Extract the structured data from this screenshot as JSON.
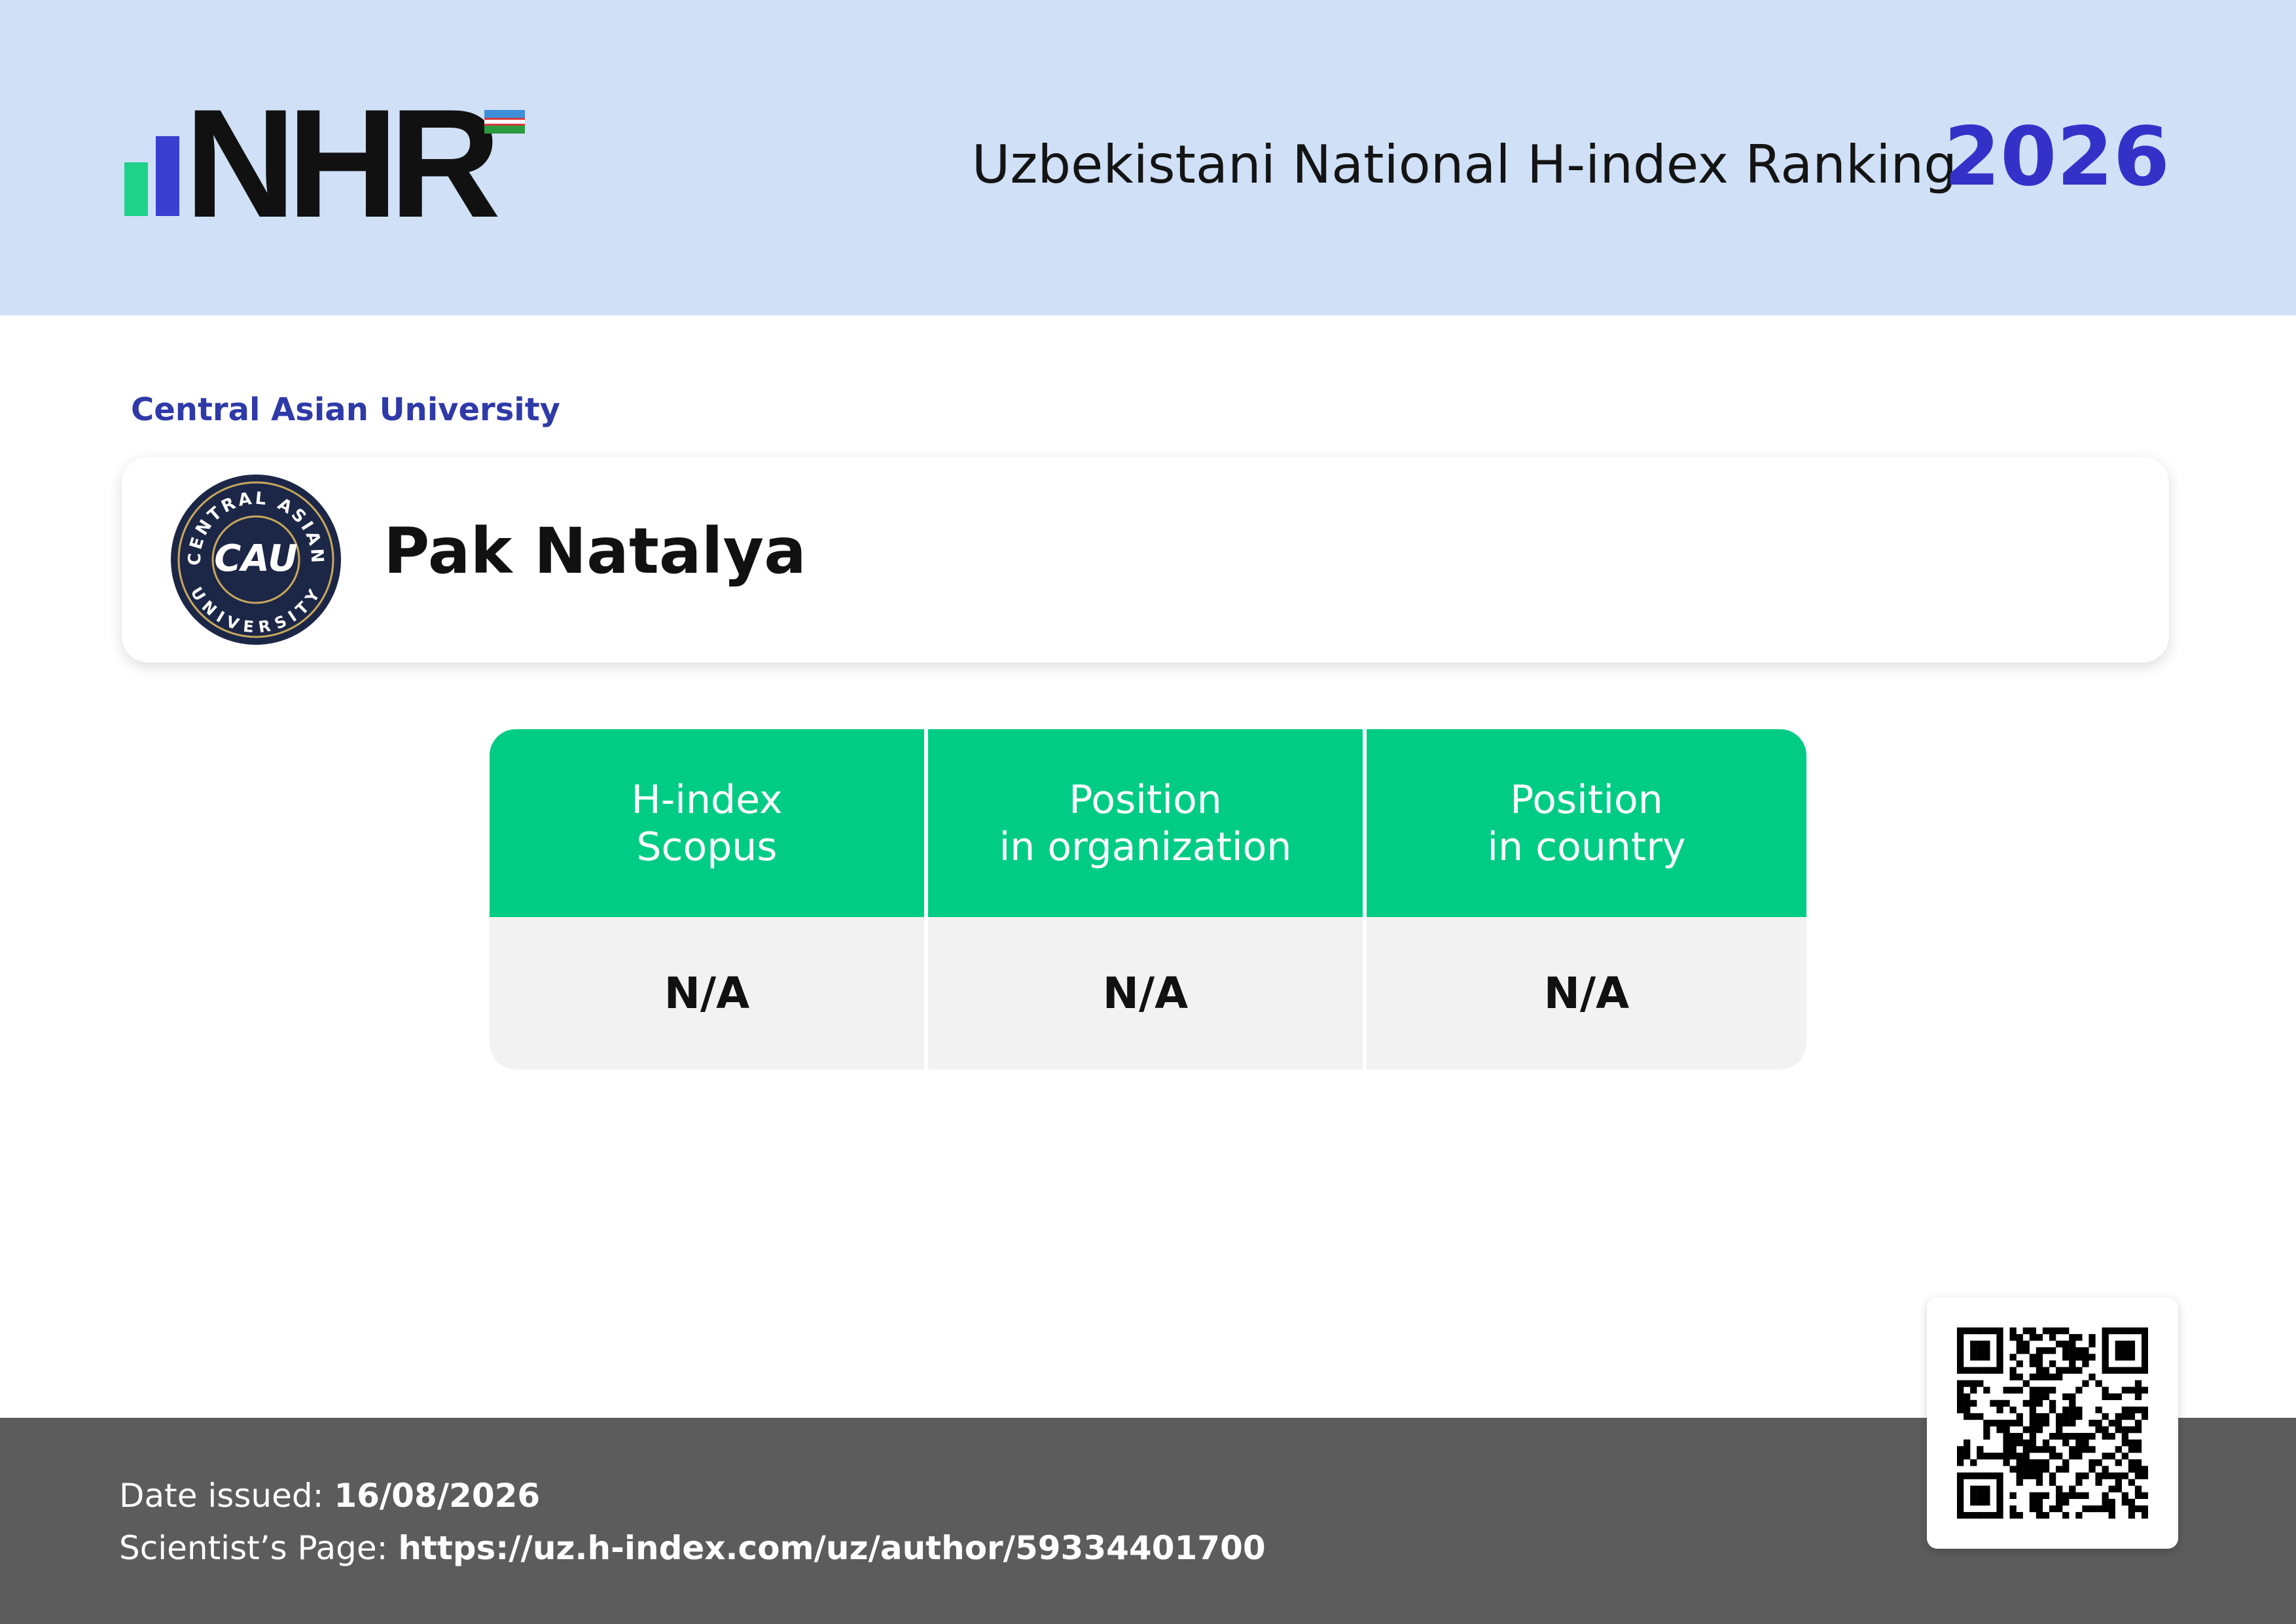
{
  "header": {
    "logo_text": "NHR",
    "title": "Uzbekistani National H-index Ranking",
    "year": "2026"
  },
  "organization": {
    "name": "Central Asian University",
    "logo_text": "CAU",
    "logo_ring_top": "CENTRAL ASIAN",
    "logo_ring_bottom": "UNIVERSITY"
  },
  "person": {
    "name": "Pak Natalya"
  },
  "stats": {
    "columns": [
      {
        "line1": "H-index",
        "line2": "Scopus",
        "value": "N/A"
      },
      {
        "line1": "Position",
        "line2": "in organization",
        "value": "N/A"
      },
      {
        "line1": "Position",
        "line2": "in country",
        "value": "N/A"
      }
    ]
  },
  "footer": {
    "date_label": "Date issued:",
    "date_value": "16/08/2026",
    "page_label": "Scientist’s Page:",
    "page_value": "https://uz.h-index.com/uz/author/59334401700"
  },
  "colors": {
    "header_bg": "#cfe0f7",
    "accent_blue": "#3431c9",
    "accent_green": "#00cc85",
    "footer_bg": "#5c5c5c"
  },
  "icons": {
    "qr": "qr-code-icon"
  }
}
